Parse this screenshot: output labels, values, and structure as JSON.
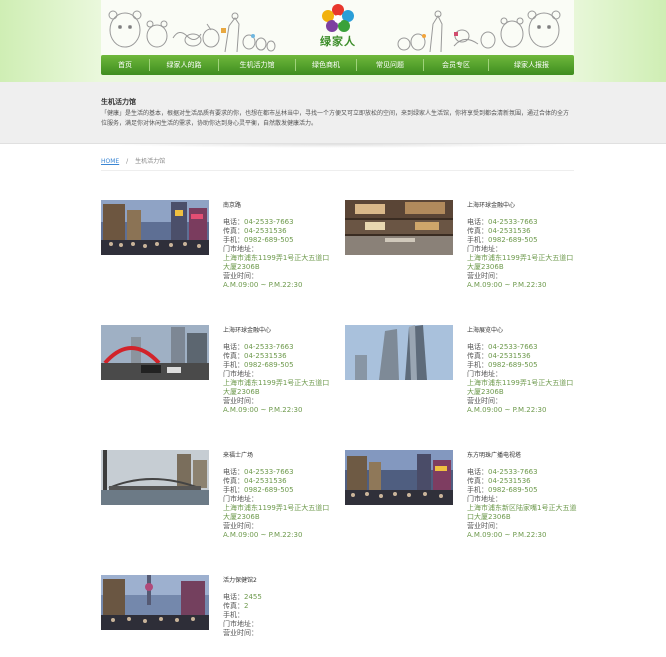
{
  "brand": {
    "name": "绿家人"
  },
  "nav": {
    "items": [
      "首页",
      "绿家人的路",
      "生机活力馆",
      "绿色商机",
      "常见问题",
      "会员专区",
      "绿家人报报"
    ]
  },
  "intro": {
    "title": "生机活力馆",
    "text": "「健康」是生活的基本，根据对生活品质有要求的你，也想在都市丛林当中，寻找一个方便又可立即放松的空间，来到绿家人生活馆，你将享受到都会清新氛围，通过合体的全方位服务，满足你对休闲生活的需求，协助你达到身心灵平衡，自然散发健康活力。"
  },
  "breadcrumb": {
    "home": "HOME",
    "sep": "/",
    "current": "生机活力馆"
  },
  "labels": {
    "phone": "电话：",
    "fax": "传真：",
    "mobile": "手机：",
    "address": "门市地址：",
    "hours": "营业时间："
  },
  "stores": [
    {
      "name": "南京路",
      "phone": "04-2533-7663",
      "fax": "04-2531536",
      "mobile": "0982-689-505",
      "address": "上海市浦东1199弄1号正大五道口大厦2306B",
      "hours": "A.M.09:00 ~ P.M.22:30",
      "photo": "shopping-street-night"
    },
    {
      "name": "上海环球金融中心",
      "phone": "04-2533-7663",
      "fax": "04-2531536",
      "mobile": "0982-689-505",
      "address": "上海市浦东1199弄1号正大五道口大厦2306B",
      "hours": "A.M.09:00 ~ P.M.22:30",
      "photo": "mall-interior"
    },
    {
      "name": "上海环球金融中心",
      "phone": "04-2533-7663",
      "fax": "04-2531536",
      "mobile": "0982-689-505",
      "address": "上海市浦东1199弄1号正大五道口大厦2306B",
      "hours": "A.M.09:00 ~ P.M.22:30",
      "photo": "red-arch-street"
    },
    {
      "name": "上海展览中心",
      "phone": "04-2533-7663",
      "fax": "04-2531536",
      "mobile": "0982-689-505",
      "address": "上海市浦东1199弄1号正大五道口大厦2306B",
      "hours": "A.M.09:00 ~ P.M.22:30",
      "photo": "skyscrapers"
    },
    {
      "name": "来福士广场",
      "phone": "04-2533-7663",
      "fax": "04-2531536",
      "mobile": "0982-689-505",
      "address": "上海市浦东1199弄1号正大五道口大厦2306B",
      "hours": "A.M.09:00 ~ P.M.22:30",
      "photo": "bridge-skyline"
    },
    {
      "name": "东方明珠广播电视塔",
      "phone": "04-2533-7663",
      "fax": "04-2531536",
      "mobile": "0982-689-505",
      "address": "上海市浦东新区陆家嘴1号正大五道口大厦2306B",
      "hours": "A.M.09:00 ~ P.M.22:30",
      "photo": "crowded-street"
    },
    {
      "name": "活力保健馆2",
      "phone": "2455",
      "fax": "2",
      "mobile": "",
      "address": "",
      "hours": "",
      "photo": "street-tower"
    }
  ]
}
